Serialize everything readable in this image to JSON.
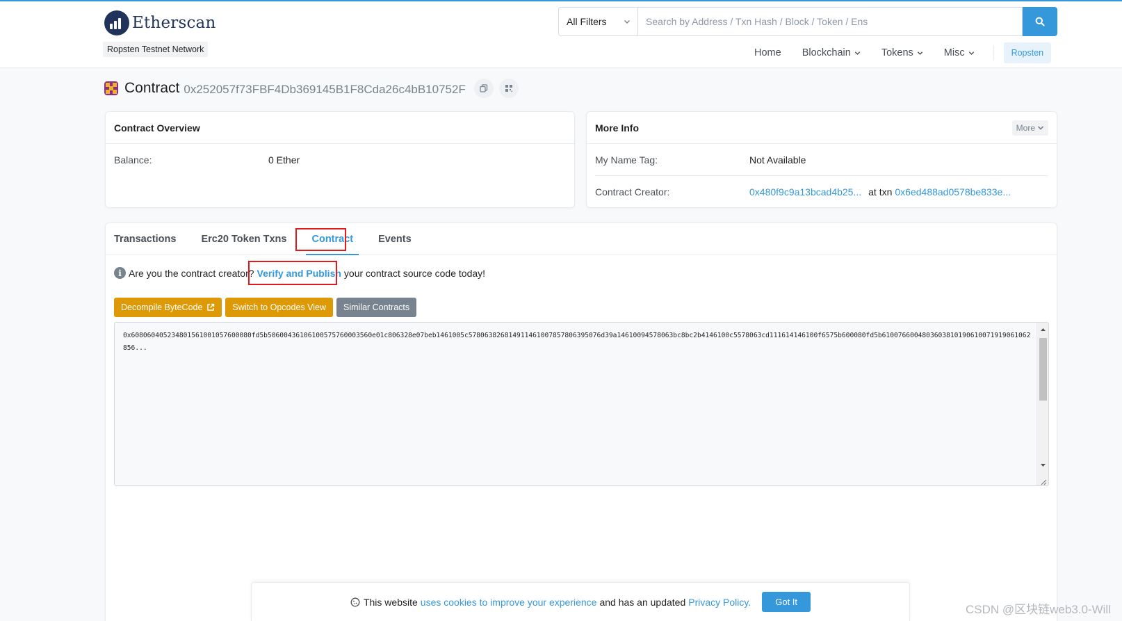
{
  "header": {
    "logo_text": "Etherscan",
    "network_badge": "Ropsten Testnet Network",
    "search": {
      "filter": "All Filters",
      "placeholder": "Search by Address / Txn Hash / Block / Token / Ens"
    },
    "nav": {
      "home": "Home",
      "blockchain": "Blockchain",
      "tokens": "Tokens",
      "misc": "Misc",
      "network": "Ropsten"
    }
  },
  "title": {
    "word": "Contract",
    "address": "0x252057f73FBF4Db369145B1F8Cda26c4bB10752F"
  },
  "overview": {
    "heading": "Contract Overview",
    "balance_label": "Balance:",
    "balance_value": "0 Ether"
  },
  "more_info": {
    "heading": "More Info",
    "more_button": "More",
    "name_tag_label": "My Name Tag:",
    "name_tag_value": "Not Available",
    "creator_label": "Contract Creator:",
    "creator_address": "0x480f9c9a13bcad4b25...",
    "at_txn": "at txn",
    "creator_txn": "0x6ed488ad0578be833e..."
  },
  "tabs": {
    "transactions": "Transactions",
    "erc20": "Erc20 Token Txns",
    "contract": "Contract",
    "events": "Events"
  },
  "notice": {
    "before": "Are you the contract creator?",
    "link": "Verify and Publish",
    "after": "your contract source code today!"
  },
  "buttons": {
    "decompile": "Decompile ByteCode",
    "opcodes": "Switch to Opcodes View",
    "similar": "Similar Contracts"
  },
  "bytecode": "0x608060405234801561001057600080fd5b50600436106100575760003560e01c806328e07beb1461005c578063826814911461007857806395076d39a14610094578063bc8bc2b4146100c5578063cd111614146100f6575b600080fd5b6100766004803603810190610071919061062856...",
  "cookie": {
    "before": "This website",
    "link1": "uses cookies to improve your experience",
    "middle": "and has an updated",
    "link2": "Privacy Policy.",
    "button": "Got It"
  },
  "watermark": "CSDN @区块链web3.0-Will"
}
